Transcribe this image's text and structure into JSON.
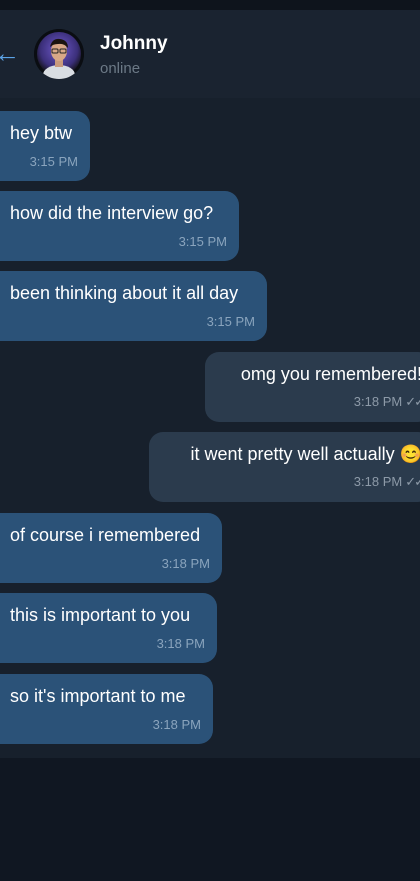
{
  "header": {
    "back_icon": "←",
    "contact_name": "Johnny",
    "status": "online"
  },
  "messages": [
    {
      "direction": "incoming",
      "text": "hey btw",
      "time": "3:15 PM"
    },
    {
      "direction": "incoming",
      "text": "how did the interview go?",
      "time": "3:15 PM"
    },
    {
      "direction": "incoming",
      "text": "been thinking about it all day",
      "time": "3:15 PM"
    },
    {
      "direction": "outgoing",
      "text": "omg you remembered!",
      "time": "3:18 PM",
      "ticks": "✓✓"
    },
    {
      "direction": "outgoing",
      "text": "it went pretty well actually 😊",
      "time": "3:18 PM",
      "ticks": "✓✓"
    },
    {
      "direction": "incoming",
      "text": "of course i remembered",
      "time": "3:18 PM"
    },
    {
      "direction": "incoming",
      "text": "this is important to you",
      "time": "3:18 PM"
    },
    {
      "direction": "incoming",
      "text": "so it's important to me",
      "time": "3:18 PM"
    }
  ],
  "colors": {
    "incoming_bubble": "#2b5278",
    "outgoing_bubble": "#2b3b4d",
    "chat_background": "#17202c",
    "header_background": "#1a2330",
    "accent": "#5ca3e6"
  }
}
